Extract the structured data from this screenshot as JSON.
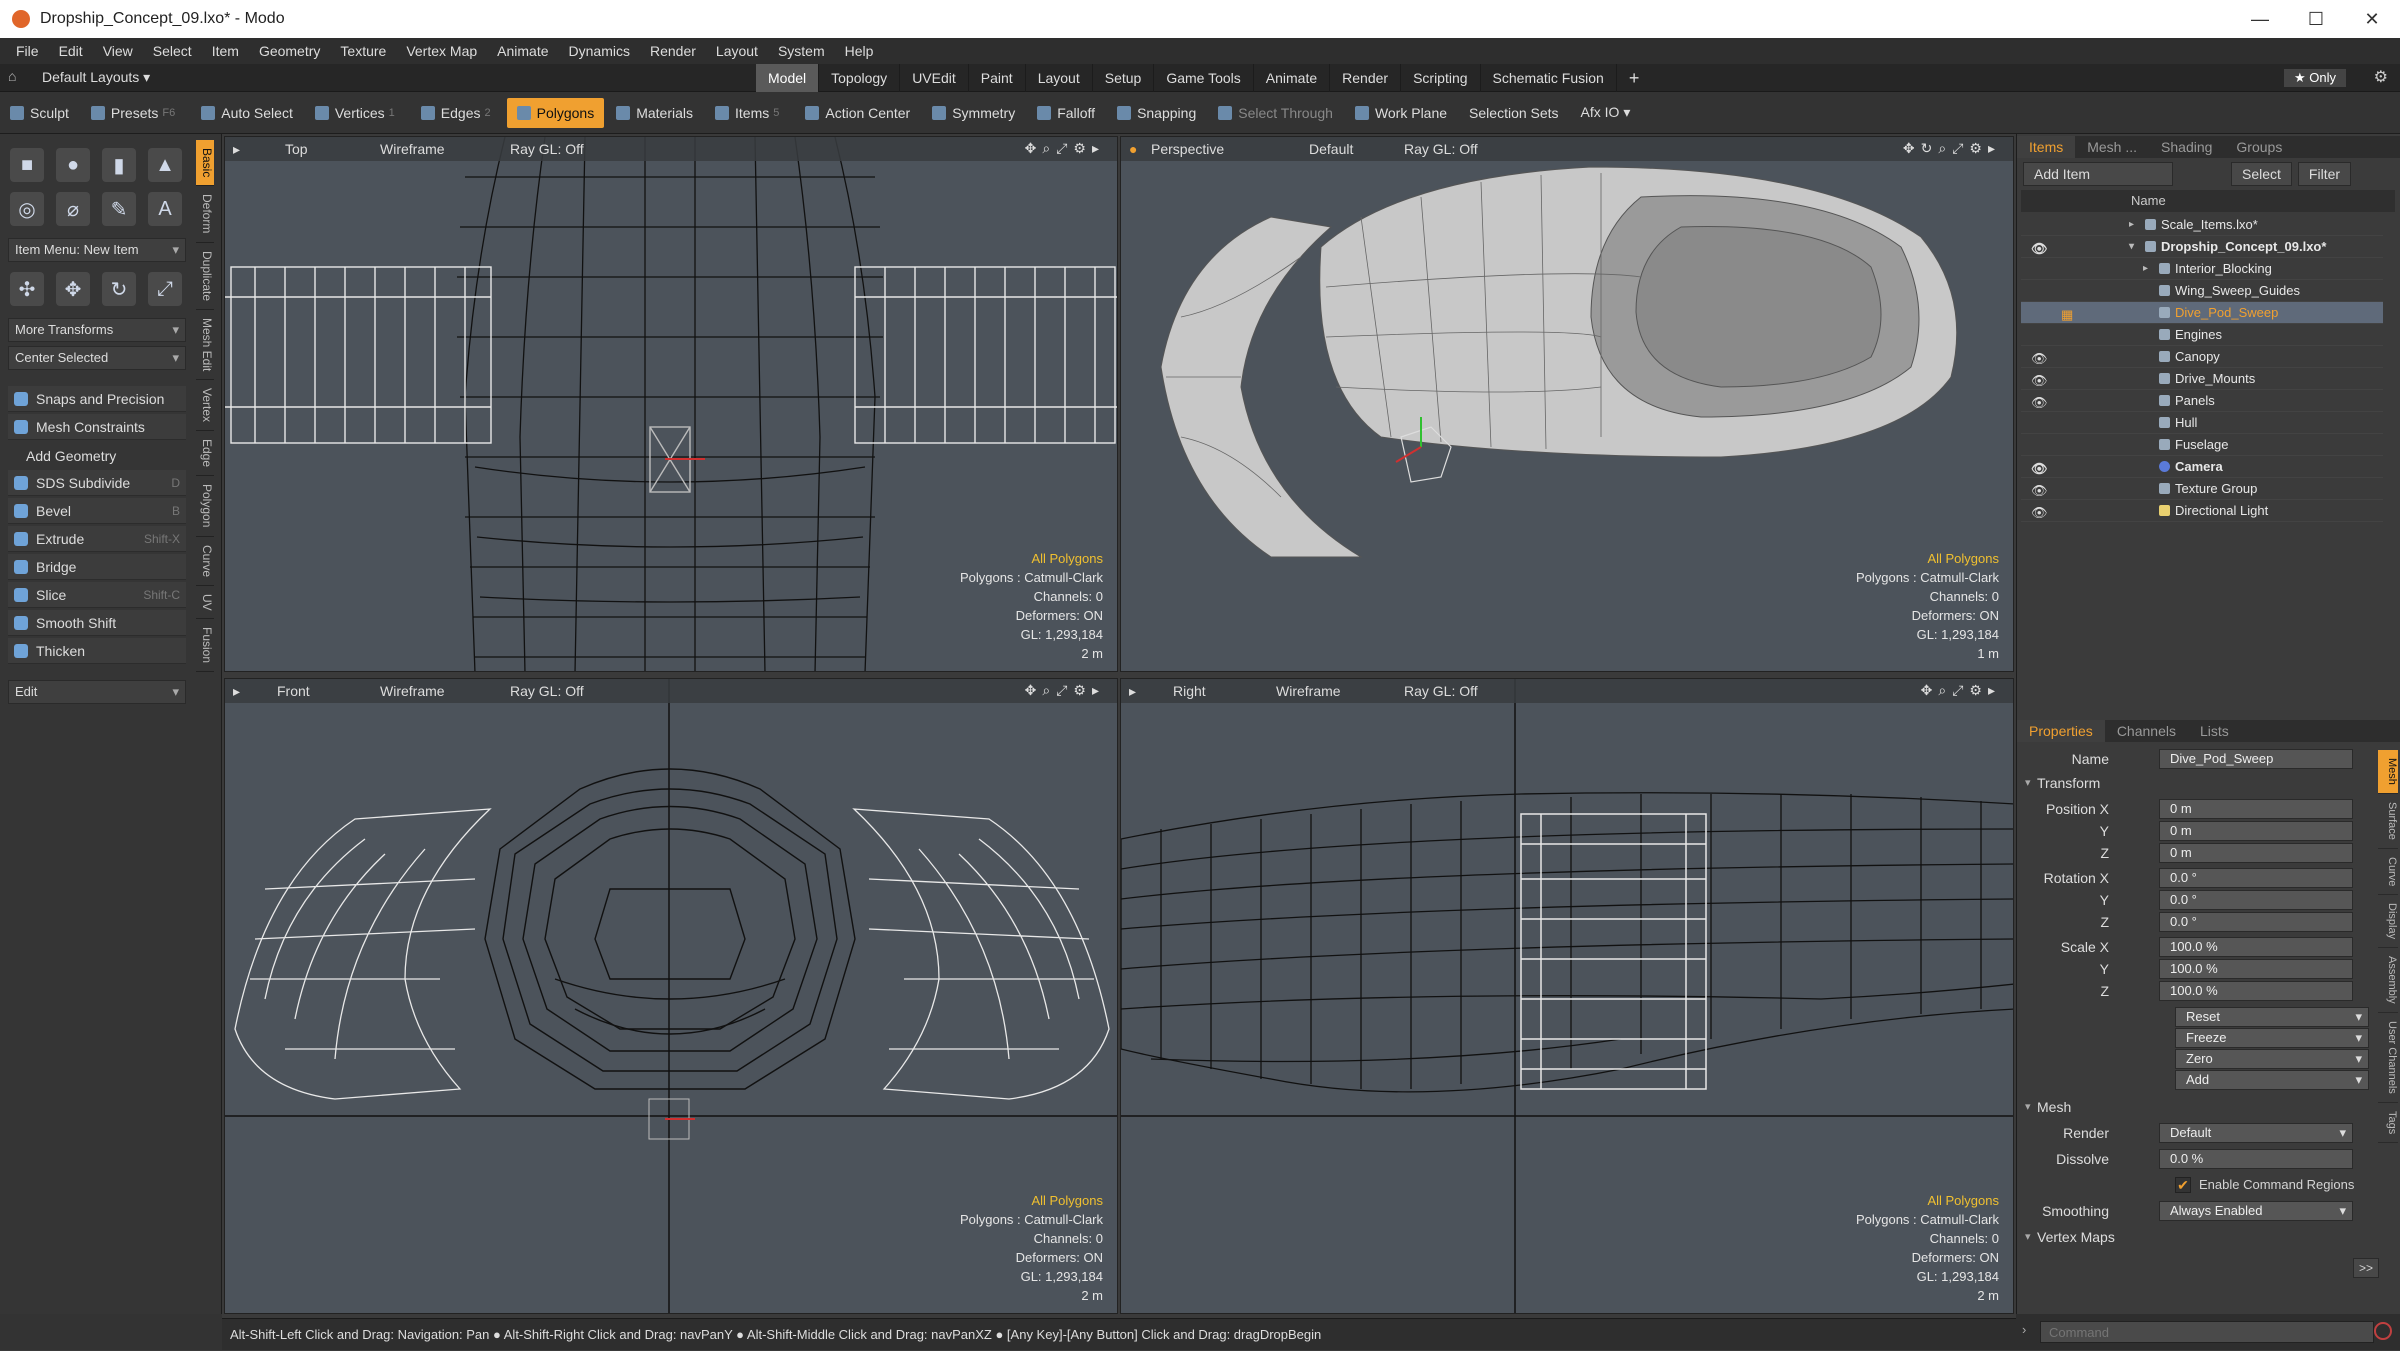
{
  "window": {
    "title": "Dropship_Concept_09.lxo* - Modo",
    "min": "—",
    "max": "☐",
    "close": "✕"
  },
  "menu": [
    "File",
    "Edit",
    "View",
    "Select",
    "Item",
    "Geometry",
    "Texture",
    "Vertex Map",
    "Animate",
    "Dynamics",
    "Render",
    "Layout",
    "System",
    "Help"
  ],
  "layoutbar": {
    "layouts": "Default Layouts ▾",
    "tabs": [
      "Model",
      "Topology",
      "UVEdit",
      "Paint",
      "Layout",
      "Setup",
      "Game Tools",
      "Animate",
      "Render",
      "Scripting",
      "Schematic Fusion"
    ],
    "active_tab": "Model",
    "only": "★ Only"
  },
  "toolbar": {
    "sculpt": "Sculpt",
    "presets": "Presets",
    "presets_key": "F6",
    "auto_select": "Auto Select",
    "vertices": "Vertices",
    "vertices_key": "1",
    "edges": "Edges",
    "edges_key": "2",
    "polygons": "Polygons",
    "materials": "Materials",
    "items": "Items",
    "items_key": "5",
    "action_center": "Action Center",
    "symmetry": "Symmetry",
    "falloff": "Falloff",
    "snapping": "Snapping",
    "select_through": "Select Through",
    "work_plane": "Work Plane",
    "selection_sets": "Selection Sets",
    "afx_io": "Afx IO ▾"
  },
  "leftpanel": {
    "vtabs": [
      "Basic",
      "Deform",
      "Duplicate",
      "Mesh Edit",
      "Vertex",
      "Edge",
      "Polygon",
      "Curve",
      "UV",
      "Fusion"
    ],
    "item_menu": "Item Menu: New Item",
    "more_transforms": "More Transforms",
    "center_selected": "Center Selected",
    "snaps": "Snaps and Precision",
    "mesh_constraints": "Mesh Constraints",
    "add_geometry": "Add Geometry",
    "tools": [
      {
        "label": "SDS Subdivide",
        "key": "D"
      },
      {
        "label": "Bevel",
        "key": "B"
      },
      {
        "label": "Extrude",
        "key": "Shift-X"
      },
      {
        "label": "Bridge",
        "key": ""
      },
      {
        "label": "Slice",
        "key": "Shift-C"
      },
      {
        "label": "Smooth Shift",
        "key": ""
      },
      {
        "label": "Thicken",
        "key": ""
      }
    ],
    "edit": "Edit"
  },
  "viewports": [
    {
      "view": "Top",
      "shade": "Wireframe",
      "ray": "Ray GL: Off",
      "sel": "All Polygons",
      "poly": "Polygons : Catmull-Clark",
      "channels": "Channels: 0",
      "deformers": "Deformers: ON",
      "gl": "GL: 1,293,184",
      "scale": "2 m"
    },
    {
      "view": "Perspective",
      "shade": "Default",
      "ray": "Ray GL: Off",
      "sel": "All Polygons",
      "poly": "Polygons : Catmull-Clark",
      "channels": "Channels: 0",
      "deformers": "Deformers: ON",
      "gl": "GL: 1,293,184",
      "scale": "1 m"
    },
    {
      "view": "Front",
      "shade": "Wireframe",
      "ray": "Ray GL: Off",
      "sel": "All Polygons",
      "poly": "Polygons : Catmull-Clark",
      "channels": "Channels: 0",
      "deformers": "Deformers: ON",
      "gl": "GL: 1,293,184",
      "scale": "2 m"
    },
    {
      "view": "Right",
      "shade": "Wireframe",
      "ray": "Ray GL: Off",
      "sel": "All Polygons",
      "poly": "Polygons : Catmull-Clark",
      "channels": "Channels: 0",
      "deformers": "Deformers: ON",
      "gl": "GL: 1,293,184",
      "scale": "2 m"
    }
  ],
  "items_panel": {
    "tabs": [
      "Items",
      "Mesh ...",
      "Shading",
      "Groups"
    ],
    "add_item": "Add Item",
    "select": "Select",
    "filter": "Filter",
    "name_col": "Name",
    "rows": [
      {
        "label": "Scale_Items.lxo*"
      },
      {
        "label": "Dropship_Concept_09.lxo*"
      },
      {
        "label": "Interior_Blocking"
      },
      {
        "label": "Wing_Sweep_Guides"
      },
      {
        "label": "Dive_Pod_Sweep"
      },
      {
        "label": "Engines"
      },
      {
        "label": "Canopy"
      },
      {
        "label": "Drive_Mounts"
      },
      {
        "label": "Panels"
      },
      {
        "label": "Hull"
      },
      {
        "label": "Fuselage"
      },
      {
        "label": "Camera"
      },
      {
        "label": "Texture Group"
      },
      {
        "label": "Directional Light"
      }
    ]
  },
  "properties": {
    "tabs": [
      "Properties",
      "Channels",
      "Lists"
    ],
    "name_label": "Name",
    "name_value": "Dive_Pod_Sweep",
    "transform": "Transform",
    "pos_label": "Position X",
    "pos": [
      "0 m",
      "0 m",
      "0 m"
    ],
    "rot_label": "Rotation X",
    "rot": [
      "0.0 °",
      "0.0 °",
      "0.0 °"
    ],
    "scale_label": "Scale X",
    "scale": [
      "100.0 %",
      "100.0 %",
      "100.0 %"
    ],
    "y": "Y",
    "z": "Z",
    "reset": "Reset",
    "freeze": "Freeze",
    "zero": "Zero",
    "add": "Add",
    "mesh": "Mesh",
    "render_label": "Render",
    "render": "Default",
    "dissolve_label": "Dissolve",
    "dissolve": "0.0 %",
    "enable_cmd": "Enable Command Regions",
    "smoothing_label": "Smoothing",
    "smoothing": "Always Enabled",
    "vertex_maps": "Vertex Maps",
    "more": ">>",
    "vtabs": [
      "Mesh",
      "Surface",
      "Curve",
      "Display",
      "Assembly",
      "User Channels",
      "Tags"
    ]
  },
  "statusbar": "Alt-Shift-Left Click and Drag: Navigation: Pan ● Alt-Shift-Right Click and Drag: navPanY ● Alt-Shift-Middle Click and Drag: navPanXZ ● [Any Key]-[Any Button] Click and Drag: dragDropBegin",
  "command_placeholder": "Command"
}
